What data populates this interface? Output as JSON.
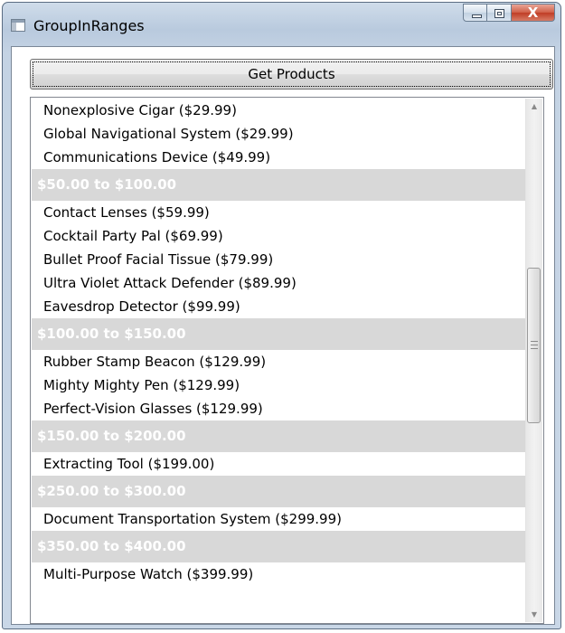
{
  "window": {
    "title": "GroupInRanges",
    "close_label": "X"
  },
  "toolbar": {
    "get_products_label": "Get Products"
  },
  "scrollbar": {
    "up_arrow": "▲",
    "down_arrow": "▼"
  },
  "list": {
    "top_items": [
      "Nonexplosive Cigar ($29.99)",
      "Global Navigational System ($29.99)",
      "Communications Device ($49.99)"
    ],
    "groups": [
      {
        "header": "$50.00 to $100.00",
        "items": [
          "Contact Lenses ($59.99)",
          "Cocktail Party Pal ($69.99)",
          "Bullet Proof Facial Tissue ($79.99)",
          "Ultra Violet Attack Defender ($89.99)",
          "Eavesdrop Detector ($99.99)"
        ]
      },
      {
        "header": "$100.00 to $150.00",
        "items": [
          "Rubber Stamp Beacon ($129.99)",
          "Mighty Mighty Pen ($129.99)",
          "Perfect-Vision Glasses ($129.99)"
        ]
      },
      {
        "header": "$150.00 to $200.00",
        "items": [
          "Extracting Tool ($199.00)"
        ]
      },
      {
        "header": "$250.00 to $300.00",
        "items": [
          "Document Transportation System ($299.99)"
        ]
      },
      {
        "header": "$350.00 to $400.00",
        "items": [
          "Multi-Purpose Watch ($399.99)"
        ]
      }
    ]
  }
}
